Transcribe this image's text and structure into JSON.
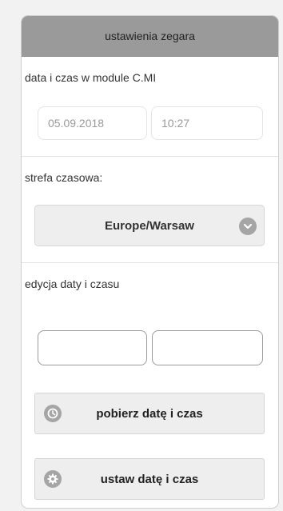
{
  "header": {
    "title": "ustawienia zegara"
  },
  "module_time": {
    "label": "data i czas w module C.MI",
    "date_value": "05.09.2018",
    "time_value": "10:27"
  },
  "timezone": {
    "label": "strefa czasowa:",
    "selected": "Europe/Warsaw",
    "icon": "chevron-down-icon"
  },
  "edit": {
    "label": "edycja daty i czasu",
    "date_value": "",
    "time_value": ""
  },
  "buttons": {
    "fetch_label": "pobierz datę i czas",
    "fetch_icon": "clock-icon",
    "set_label": "ustaw datę i czas",
    "set_icon": "gear-icon"
  }
}
